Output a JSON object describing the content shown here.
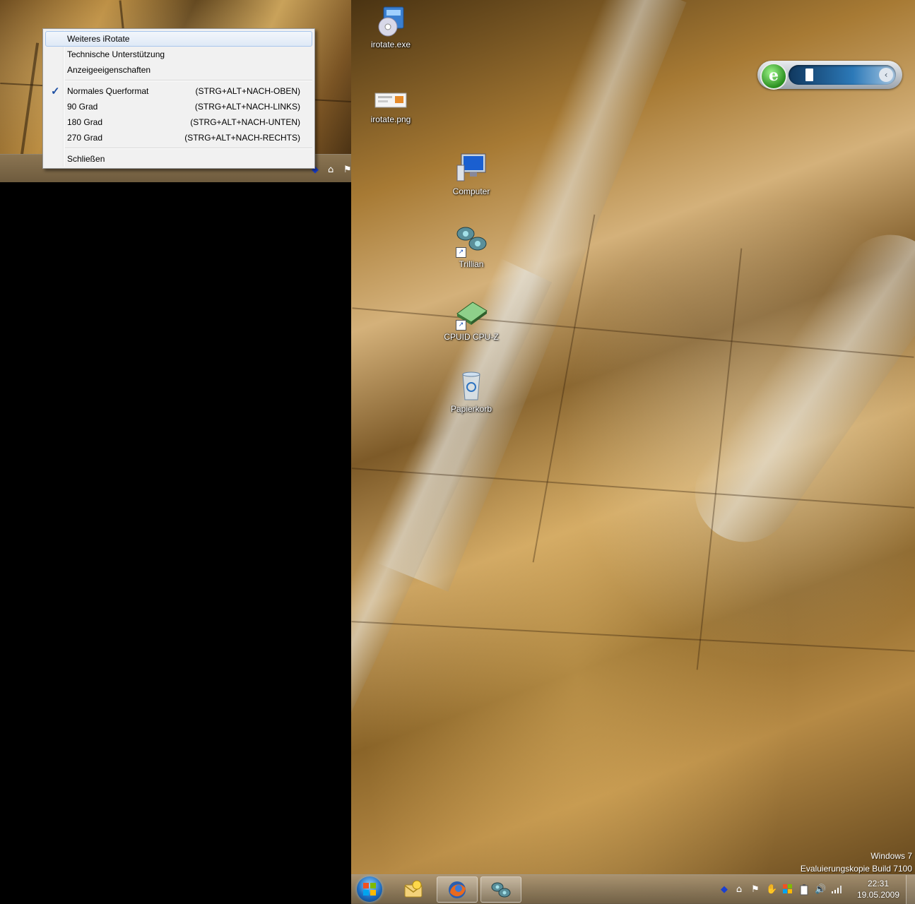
{
  "context_menu": {
    "items": [
      {
        "label": "Weiteres iRotate",
        "shortcut": "",
        "checked": false
      },
      {
        "label": "Technische Unterstützung",
        "shortcut": "",
        "checked": false
      },
      {
        "label": "Anzeigeeigenschaften",
        "shortcut": "",
        "checked": false
      },
      {
        "label": "Normales Querformat",
        "shortcut": "(STRG+ALT+NACH-OBEN)",
        "checked": true
      },
      {
        "label": "90 Grad",
        "shortcut": "(STRG+ALT+NACH-LINKS)",
        "checked": false
      },
      {
        "label": "180 Grad",
        "shortcut": "(STRG+ALT+NACH-UNTEN)",
        "checked": false
      },
      {
        "label": "270 Grad",
        "shortcut": "(STRG+ALT+NACH-RECHTS)",
        "checked": false
      },
      {
        "label": "Schließen",
        "shortcut": "",
        "checked": false
      }
    ],
    "hovered_item": "Weiteres iRotate",
    "check_glyph": "✓"
  },
  "desktop_icons": [
    {
      "label": "irotate.exe",
      "icon": "installer-cd-icon"
    },
    {
      "label": "irotate.png",
      "icon": "image-file-icon"
    },
    {
      "label": "Computer",
      "icon": "computer-icon"
    },
    {
      "label": "Trillian",
      "icon": "trillian-icon",
      "shortcut": true
    },
    {
      "label": "CPUID CPU-Z",
      "icon": "cpu-chip-icon",
      "shortcut": true
    },
    {
      "label": "Papierkorb",
      "icon": "recycle-bin-icon"
    }
  ],
  "gadget": {
    "logo_letter": "e",
    "icon": "battery-icon",
    "expand": "‹"
  },
  "watermark": {
    "line1": "Windows 7",
    "line2": "Evaluierungskopie Build 7100"
  },
  "taskbar": {
    "pinned": [
      "outlook-icon",
      "firefox-icon",
      "trillian-icon"
    ],
    "active": "trillian-icon",
    "clock": {
      "time": "22:31",
      "date": "19.05.2009"
    },
    "tray_icons": [
      "irotate-icon",
      "network-share-icon",
      "action-center-flag-icon",
      "hand-icon",
      "windows-flag-icon",
      "battery-icon",
      "volume-icon",
      "signal-icon"
    ]
  },
  "colors": {
    "menu_bg": "#f1f1f1",
    "menu_hover": "#dfe9f6",
    "check": "#1d4fa3",
    "accent_blue": "#1f6fc2"
  }
}
